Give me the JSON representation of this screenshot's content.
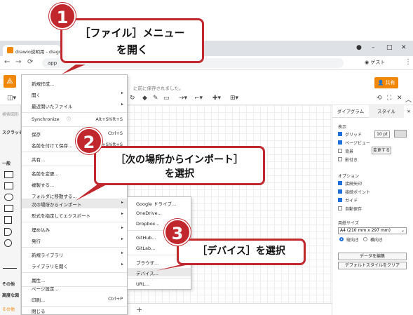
{
  "browser": {
    "tab_title": "drawio説明用 - diagrams",
    "url": "app",
    "guest_label": "ゲスト",
    "win_min": "–",
    "win_max": "□",
    "win_close": "✕"
  },
  "app": {
    "saved_note": "に前に保存されました。",
    "share_label": "共有"
  },
  "left_panel": {
    "search_placeholder": "検索図形",
    "scratchpad": "スクラッチ",
    "general": "一般",
    "other": "その他",
    "advanced": "高度な図",
    "more_shapes": "その他"
  },
  "file_menu": {
    "items": [
      {
        "label": "新規作成..."
      },
      {
        "label": "開く"
      },
      {
        "label": "最近開いたファイル"
      },
      {
        "label": "Synchronize",
        "shortcut": "Alt+Shift+S"
      },
      {
        "label": "保存",
        "shortcut": "Ctrl+S"
      },
      {
        "label": "名前を付けて保存...",
        "shortcut": "Ctrl+Shift+S"
      },
      {
        "label": "共有..."
      },
      {
        "label": "名前を変更..."
      },
      {
        "label": "複製する..."
      },
      {
        "label": "フォルダに移動する..."
      },
      {
        "label": "次の場所からインポート"
      },
      {
        "label": "形式を指定してエクスポート"
      },
      {
        "label": "埋め込み"
      },
      {
        "label": "発行"
      },
      {
        "label": "新規ライブラリ"
      },
      {
        "label": "ライブラリを開く"
      },
      {
        "label": "属性..."
      },
      {
        "label": "ページ設定..."
      },
      {
        "label": "印刷...",
        "shortcut": "Ctrl+P"
      },
      {
        "label": "閉じる"
      }
    ]
  },
  "import_submenu": {
    "items": [
      {
        "label": "Google ドライブ..."
      },
      {
        "label": "OneDrive..."
      },
      {
        "label": "Dropbox..."
      },
      {
        "label": "GitHub..."
      },
      {
        "label": "GitLab..."
      },
      {
        "label": "ブラウザ..."
      },
      {
        "label": "デバイス..."
      },
      {
        "label": "URL..."
      }
    ]
  },
  "format_panel": {
    "tab_diagram": "ダイアグラム",
    "tab_style": "スタイル",
    "display_label": "表示",
    "grid_label": "グリッド",
    "grid_size": "10 pt",
    "page_view_label": "ページビュー",
    "background_label": "背景",
    "change_button": "変更する",
    "shadow_label": "影付き",
    "options_label": "オプション",
    "connection_arrows": "接続矢印",
    "connection_points": "接続ポイント",
    "guides": "ガイド",
    "autosave": "自動保存",
    "paper_size_label": "用紙サイズ",
    "paper_size_value": "A4 (210 mm x 297 mm)",
    "portrait": "縦向き",
    "landscape": "横向き",
    "edit_data_button": "データを編集",
    "clear_style_button": "デフォルトスタイルをクリア"
  },
  "callouts": {
    "c1_number": "1",
    "c1_text_line1": "［ファイル］メニュー",
    "c1_text_line2": "を開く",
    "c2_number": "2",
    "c2_text_line1": "［次の場所からインポート］",
    "c2_text_line2": "を選択",
    "c3_number": "3",
    "c3_text": "［デバイス］を選択",
    "color": "#c0282d"
  }
}
